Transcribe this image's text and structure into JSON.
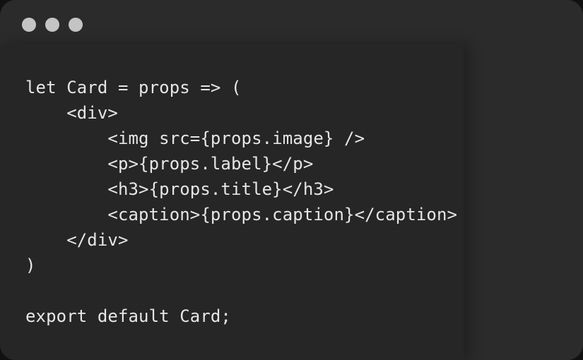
{
  "window": {
    "controls": [
      {
        "icon": "window-close-icon"
      },
      {
        "icon": "window-minimize-icon"
      },
      {
        "icon": "window-zoom-icon"
      }
    ]
  },
  "code": {
    "language": "jsx",
    "lines": [
      "let Card = props => (",
      "    <div>",
      "        <img src={props.image} />",
      "        <p>{props.label}</p>",
      "        <h3>{props.title}</h3>",
      "        <caption>{props.caption}</caption>",
      "    </div>",
      ")",
      "",
      "export default Card;"
    ]
  }
}
